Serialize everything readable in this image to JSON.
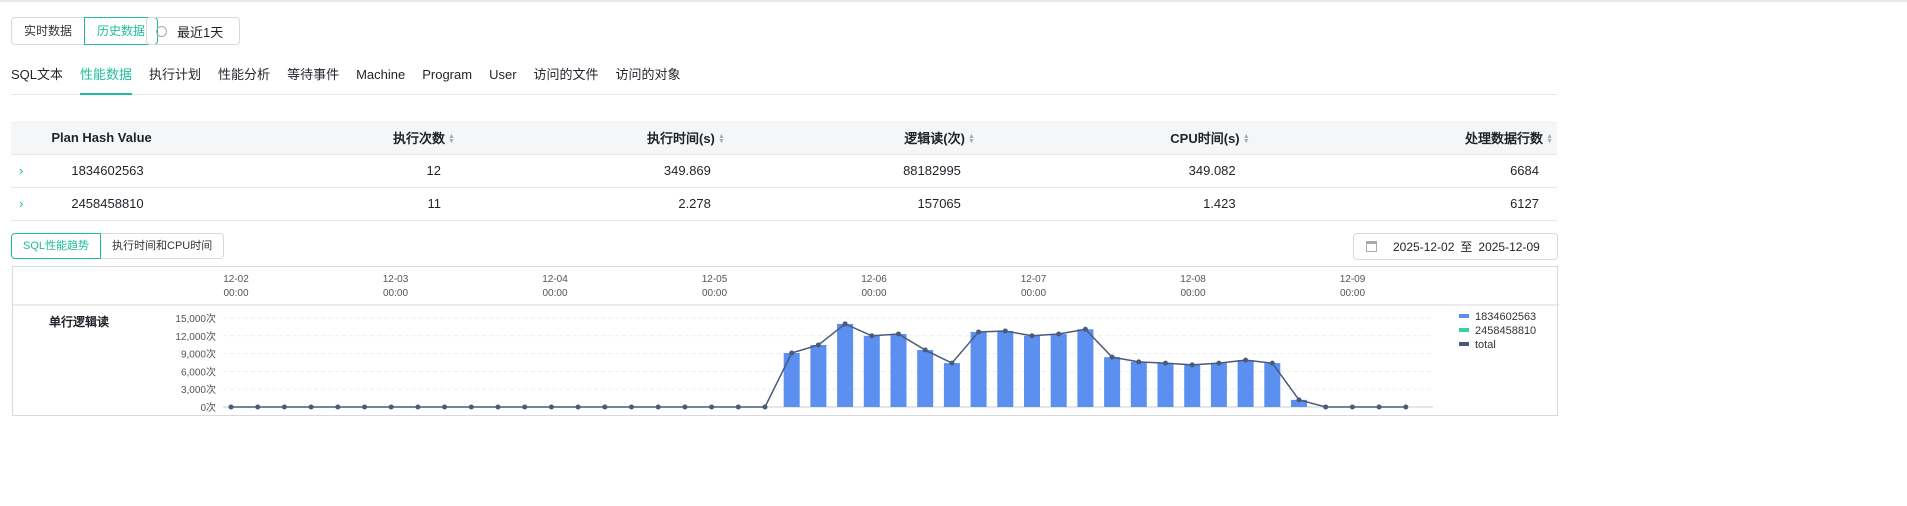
{
  "mode_toggle": [
    "实时数据",
    "历史数据"
  ],
  "time_range": "最近1天",
  "tabs": [
    "SQL文本",
    "性能数据",
    "执行计划",
    "性能分析",
    "等待事件",
    "Machine",
    "Program",
    "User",
    "访问的文件",
    "访问的对象"
  ],
  "table": {
    "headers": [
      "Plan Hash Value",
      "执行次数",
      "执行时间(s)",
      "逻辑读(次)",
      "CPU时间(s)",
      "处理数据行数"
    ],
    "rows": [
      [
        "1834602563",
        "12",
        "349.869",
        "88182995",
        "349.082",
        "6684"
      ],
      [
        "2458458810",
        "11",
        "2.278",
        "157065",
        "1.423",
        "6127"
      ]
    ]
  },
  "chart_tabs": [
    "SQL性能趋势",
    "执行时间和CPU时间"
  ],
  "date_range": {
    "start": "2025-12-02",
    "sep": "至",
    "end": "2025-12-09"
  },
  "chart_data": {
    "type": "bar",
    "title": "单行逻辑读",
    "time_labels": [
      [
        "12-02",
        "00:00"
      ],
      [
        "12-03",
        "00:00"
      ],
      [
        "12-04",
        "00:00"
      ],
      [
        "12-05",
        "00:00"
      ],
      [
        "12-06",
        "00:00"
      ],
      [
        "12-07",
        "00:00"
      ],
      [
        "12-08",
        "00:00"
      ],
      [
        "12-09",
        "00:00"
      ]
    ],
    "yticks": [
      "0次",
      "3,000次",
      "6,000次",
      "9,000次",
      "12,000次",
      "15,000次"
    ],
    "ylim": [
      0,
      15000
    ],
    "legend": [
      "1834602563",
      "2458458810",
      "total"
    ],
    "colors": [
      "#5b8ff0",
      "#3ecf9e",
      "#4a5a78"
    ],
    "series": [
      {
        "name": "1834602563",
        "values": [
          0,
          0,
          0,
          0,
          0,
          0,
          0,
          0,
          0,
          0,
          0,
          0,
          0,
          0,
          0,
          0,
          0,
          0,
          0,
          0,
          0,
          9100,
          10450,
          14000,
          12000,
          12300,
          9600,
          7400,
          12650,
          12800,
          12000,
          12300,
          13100,
          8400,
          7600,
          7400,
          7100,
          7400,
          7900,
          7400,
          1200,
          0,
          0,
          0,
          0
        ]
      },
      {
        "name": "2458458810",
        "values": []
      },
      {
        "name": "total",
        "values": [
          0,
          0,
          0,
          0,
          0,
          0,
          0,
          0,
          0,
          0,
          0,
          0,
          0,
          0,
          0,
          0,
          0,
          0,
          0,
          0,
          0,
          9100,
          10450,
          14000,
          12000,
          12300,
          9600,
          7400,
          12650,
          12800,
          12000,
          12300,
          13100,
          8400,
          7600,
          7400,
          7100,
          7400,
          7900,
          7400,
          1200,
          0,
          0,
          0,
          0
        ]
      }
    ]
  }
}
